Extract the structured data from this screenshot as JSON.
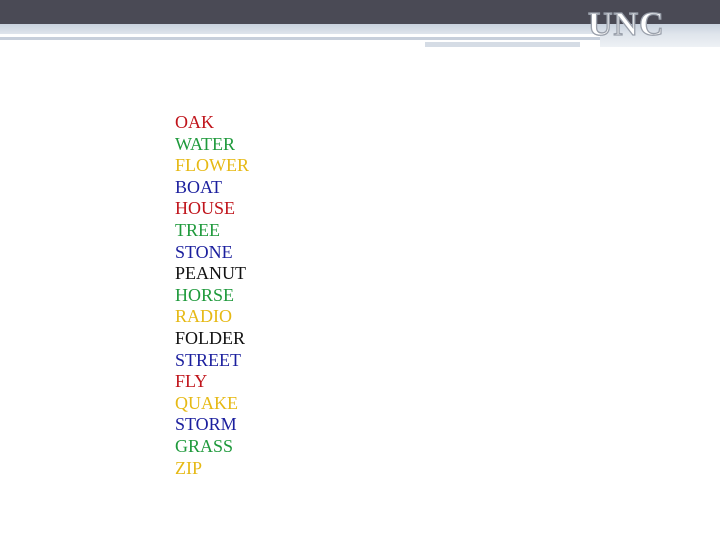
{
  "logo_text": "UNC",
  "colors": {
    "red": "#c0141b",
    "green": "#1f9a3c",
    "yellow": "#e6b914",
    "blue": "#1b1f9e",
    "black": "#111111"
  },
  "words": [
    {
      "text": "OAK",
      "color": "#c0141b"
    },
    {
      "text": "WATER",
      "color": "#1f9a3c"
    },
    {
      "text": "FLOWER",
      "color": "#e6b914"
    },
    {
      "text": "BOAT",
      "color": "#1b1f9e"
    },
    {
      "text": "HOUSE",
      "color": "#c0141b"
    },
    {
      "text": "TREE",
      "color": "#1f9a3c"
    },
    {
      "text": "STONE",
      "color": "#1b1f9e"
    },
    {
      "text": "PEANUT",
      "color": "#111111"
    },
    {
      "text": "HORSE",
      "color": "#1f9a3c"
    },
    {
      "text": "RADIO",
      "color": "#e6b914"
    },
    {
      "text": "FOLDER",
      "color": "#111111"
    },
    {
      "text": "STREET",
      "color": "#1b1f9e"
    },
    {
      "text": "FLY",
      "color": "#c0141b"
    },
    {
      "text": "QUAKE",
      "color": "#e6b914"
    },
    {
      "text": "STORM",
      "color": "#1b1f9e"
    },
    {
      "text": "GRASS",
      "color": "#1f9a3c"
    },
    {
      "text": "ZIP",
      "color": "#e6b914"
    }
  ]
}
